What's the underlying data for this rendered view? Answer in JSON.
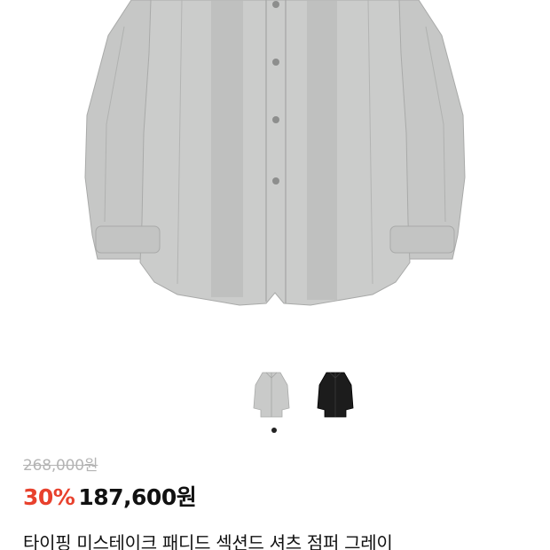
{
  "product": {
    "original_price": "268,000원",
    "discount_rate": "30%",
    "sale_price": "187,600원",
    "name": "타이핑 미스테이크 패디드 섹션드 셔츠 점퍼 그레이"
  },
  "colors": {
    "jacket_gray": "#c9cac9",
    "jacket_shadow": "#b3b4b3",
    "discount_red": "#e8412d",
    "strike_gray": "#b4b4b4",
    "black_option": "#1c1c1c"
  },
  "thumbnails": [
    {
      "color": "gray",
      "selected": true
    },
    {
      "color": "black",
      "selected": false
    }
  ],
  "carousel": {
    "active_index": 1,
    "total": 1
  }
}
